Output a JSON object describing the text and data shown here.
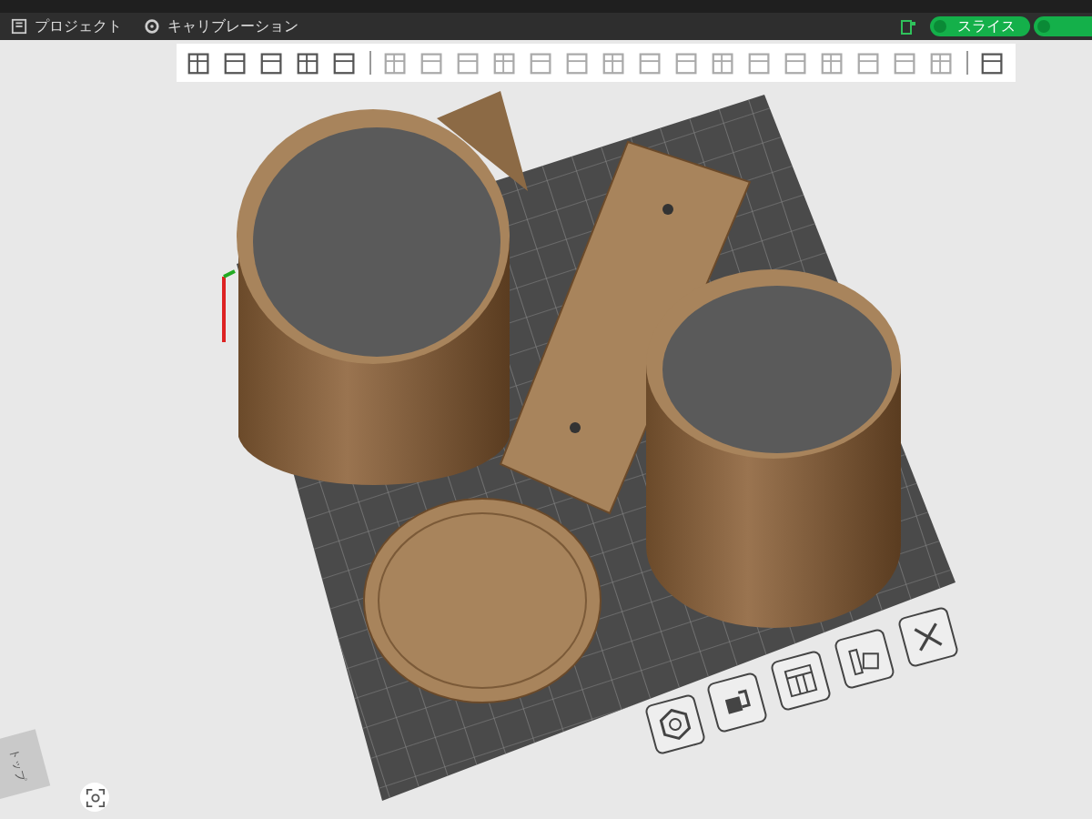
{
  "menu_tabs": [
    {
      "label": "プロジェクト",
      "kind": "project"
    },
    {
      "label": "キャリブレーション",
      "kind": "calibration"
    }
  ],
  "slice_button": {
    "label": "スライス"
  },
  "view_cube": {
    "label": "トップ"
  }
}
